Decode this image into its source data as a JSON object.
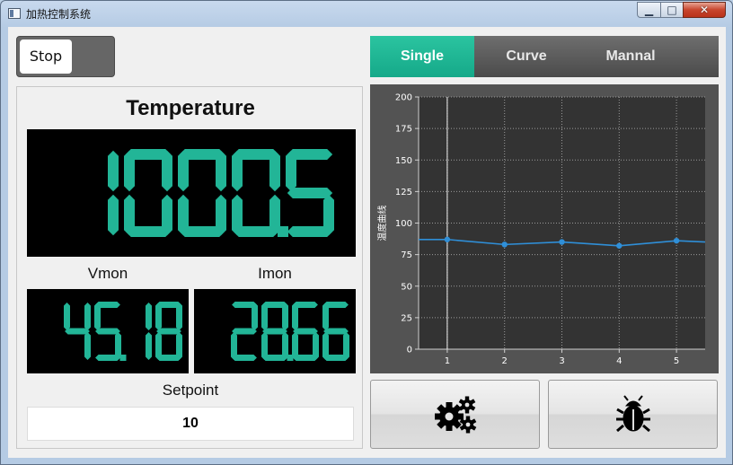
{
  "window": {
    "title": "加热控制系统",
    "min_glyph": "▁",
    "max_glyph": "□",
    "close_glyph": "✕"
  },
  "controls": {
    "run_toggle_label": "Stop",
    "temperature_title": "Temperature",
    "temperature_value": "1000.5",
    "vmon_label": "Vmon",
    "vmon_value": "45.18",
    "imon_label": "Imon",
    "imon_value": "28.66",
    "setpoint_label": "Setpoint",
    "setpoint_value": "10"
  },
  "tabs": [
    {
      "label": "Single",
      "active": true
    },
    {
      "label": "Curve",
      "active": false
    },
    {
      "label": "Mannal",
      "active": false
    }
  ],
  "buttons": {
    "settings_icon": "gears-icon",
    "debug_icon": "bug-icon"
  },
  "colors": {
    "accent": "#1ab394",
    "lcd_digit": "#22b597",
    "chart_bg": "#535353",
    "chart_plot": "#333333",
    "series": "#2f8fd8"
  },
  "chart_data": {
    "type": "line",
    "ylabel": "温度曲线",
    "xlabel": "",
    "ylim": [
      0,
      200
    ],
    "xlim": [
      0.5,
      5.5
    ],
    "yticks": [
      0,
      25,
      50,
      75,
      100,
      125,
      150,
      175,
      200
    ],
    "xticks": [
      1,
      2,
      3,
      4,
      5
    ],
    "grid": true,
    "series": [
      {
        "x": [
          0.5,
          1,
          2,
          3,
          4,
          5,
          5.5
        ],
        "y": [
          87,
          87,
          83,
          85,
          82,
          86,
          85
        ]
      }
    ],
    "markers_x": [
      1,
      2,
      3,
      4,
      5
    ]
  }
}
